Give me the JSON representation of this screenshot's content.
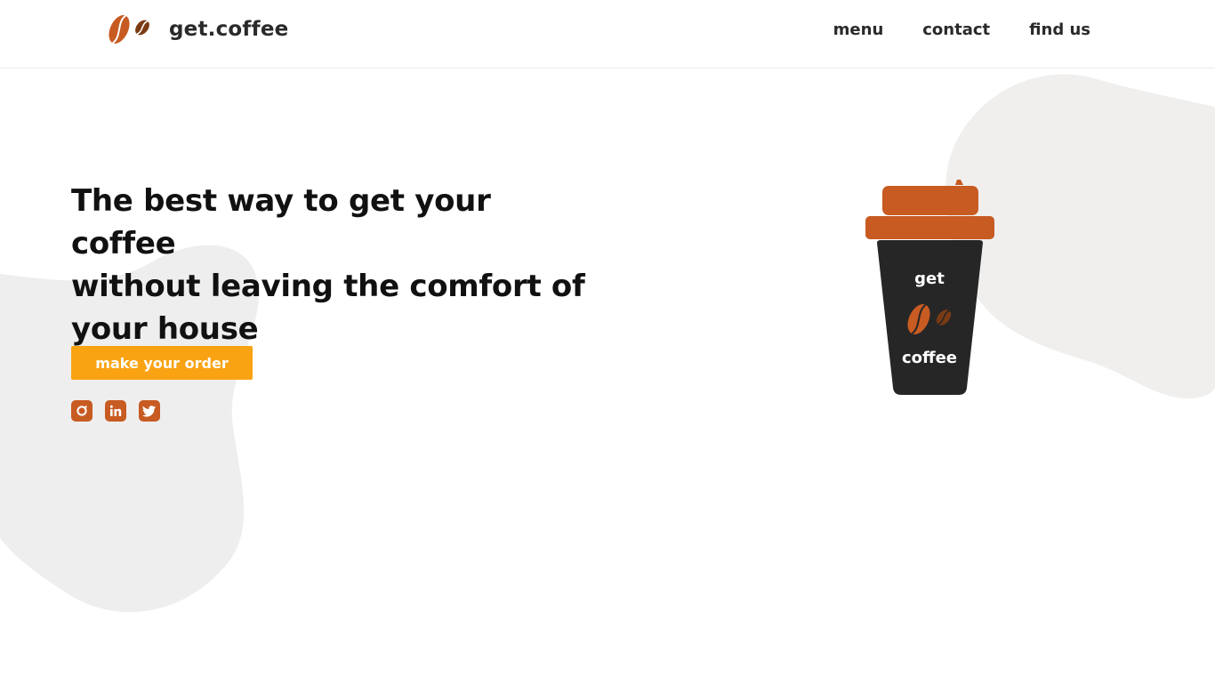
{
  "brand": {
    "name": "get.coffee",
    "icon": "coffee-beans-icon",
    "accent_color": "#c75b22",
    "bean_dark_color": "#7a3b14"
  },
  "nav": {
    "items": [
      {
        "label": "menu"
      },
      {
        "label": "contact"
      },
      {
        "label": "find us"
      }
    ]
  },
  "hero": {
    "headline_lines": [
      "The best way to get your coffee",
      "without leaving the comfort of",
      "your house"
    ],
    "cta_label": "make your order",
    "cta_color": "#f9a312"
  },
  "socials": [
    {
      "icon": "instagram-icon"
    },
    {
      "icon": "linkedin-icon"
    },
    {
      "icon": "twitter-icon"
    }
  ],
  "cup": {
    "text_top": "get",
    "text_bottom": "coffee",
    "body_color": "#262626",
    "lid_color": "#c75b22"
  },
  "background": {
    "blob_color": "#efeeed"
  }
}
